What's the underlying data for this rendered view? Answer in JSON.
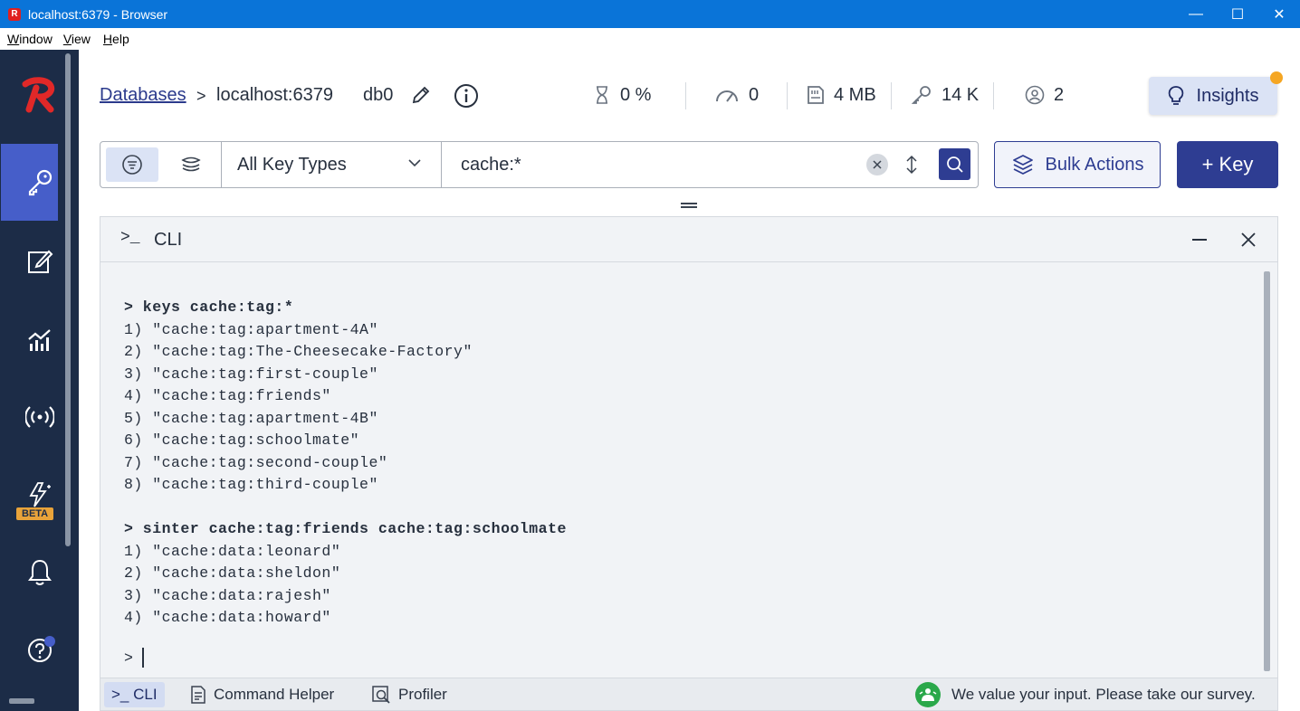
{
  "window": {
    "title": "localhost:6379 - Browser",
    "minimize": "—",
    "maximize": "☐",
    "close": "✕"
  },
  "menu": [
    "Window",
    "View",
    "Help"
  ],
  "nav": {
    "beta_label": "BETA"
  },
  "header": {
    "databases_link": "Databases",
    "separator": ">",
    "host": "localhost:6379",
    "db_index": "db0",
    "stats": {
      "cpu": "0 %",
      "ops": "0",
      "memory": "4 MB",
      "keys": "14 K",
      "clients": "2"
    },
    "insights_label": "Insights"
  },
  "filter": {
    "key_type": "All Key Types",
    "search_value": "cache:*",
    "bulk_actions_label": "Bulk Actions",
    "add_key_label": "+ Key"
  },
  "cli": {
    "prompt_icon": ">_",
    "title": "CLI",
    "output": [
      {
        "type": "cmd",
        "text": "> keys cache:tag:*"
      },
      {
        "type": "out",
        "text": "1) \"cache:tag:apartment-4A\""
      },
      {
        "type": "out",
        "text": "2) \"cache:tag:The-Cheesecake-Factory\""
      },
      {
        "type": "out",
        "text": "3) \"cache:tag:first-couple\""
      },
      {
        "type": "out",
        "text": "4) \"cache:tag:friends\""
      },
      {
        "type": "out",
        "text": "5) \"cache:tag:apartment-4B\""
      },
      {
        "type": "out",
        "text": "6) \"cache:tag:schoolmate\""
      },
      {
        "type": "out",
        "text": "7) \"cache:tag:second-couple\""
      },
      {
        "type": "out",
        "text": "8) \"cache:tag:third-couple\""
      },
      {
        "type": "gap",
        "text": ""
      },
      {
        "type": "cmd",
        "text": "> sinter cache:tag:friends cache:tag:schoolmate"
      },
      {
        "type": "out",
        "text": "1) \"cache:data:leonard\""
      },
      {
        "type": "out",
        "text": "2) \"cache:data:sheldon\""
      },
      {
        "type": "out",
        "text": "3) \"cache:data:rajesh\""
      },
      {
        "type": "out",
        "text": "4) \"cache:data:howard\""
      }
    ],
    "prompt": ">"
  },
  "footer": {
    "cli_tab": ">_ CLI",
    "command_helper_tab": "Command Helper",
    "profiler_tab": "Profiler",
    "survey_text": "We value your input. Please take our survey."
  },
  "colors": {
    "nav_bg": "#1c2c47",
    "accent": "#2e3d92",
    "nav_active": "#465ec9",
    "logo_red": "#e02828",
    "insights_dot": "#f5a623"
  }
}
